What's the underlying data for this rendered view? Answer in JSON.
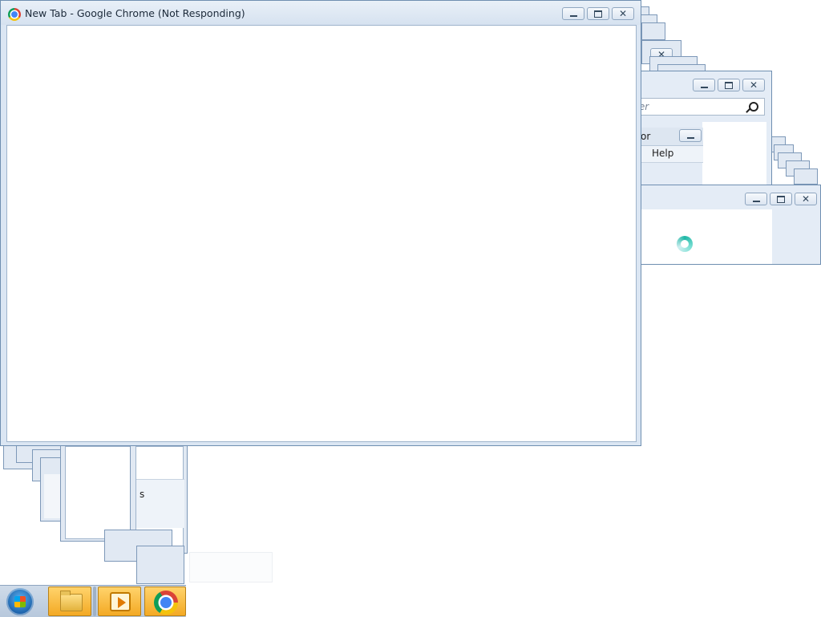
{
  "chrome_window": {
    "title": "New Tab - Google Chrome (Not Responding)"
  },
  "explorer_window": {
    "search_placeholder": "puter",
    "menu_help": "Help",
    "partial_title": "or"
  },
  "background_window": {
    "partial_text": "s"
  },
  "taskbar": {
    "items": [
      "start",
      "windows-explorer",
      "windows-media-player",
      "google-chrome"
    ]
  },
  "colors": {
    "frame": "#dbe6f3",
    "border": "#6f8fb1",
    "taskbar": "#b7c8dc"
  }
}
